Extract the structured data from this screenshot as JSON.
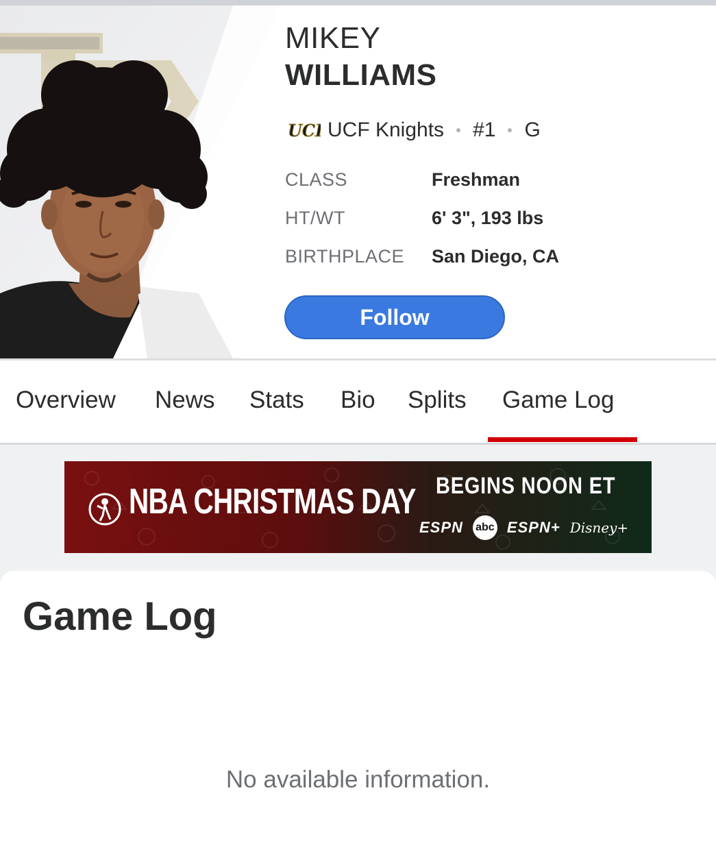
{
  "player": {
    "first_name": "MIKEY",
    "last_name": "WILLIAMS",
    "team_logo_text": "UCF",
    "team": "UCF Knights",
    "number": "#1",
    "position": "G",
    "bio": [
      {
        "label": "CLASS",
        "value": "Freshman"
      },
      {
        "label": "HT/WT",
        "value": "6' 3\", 193 lbs"
      },
      {
        "label": "BIRTHPLACE",
        "value": "San Diego, CA"
      }
    ]
  },
  "follow_button": {
    "label": "Follow",
    "color": "#3a7ae0"
  },
  "tabs": [
    {
      "label": "Overview"
    },
    {
      "label": "News"
    },
    {
      "label": "Stats"
    },
    {
      "label": "Bio"
    },
    {
      "label": "Splits"
    },
    {
      "label": "Game Log",
      "active": true
    }
  ],
  "active_tab_color": "#d00000",
  "ad": {
    "title": "NBA CHRISTMAS DAY",
    "subtitle": "BEGINS NOON ET",
    "brands": [
      "ESPN",
      "abc",
      "ESPN+",
      "Disney+"
    ]
  },
  "game_log": {
    "title": "Game Log",
    "empty_message": "No available information."
  }
}
